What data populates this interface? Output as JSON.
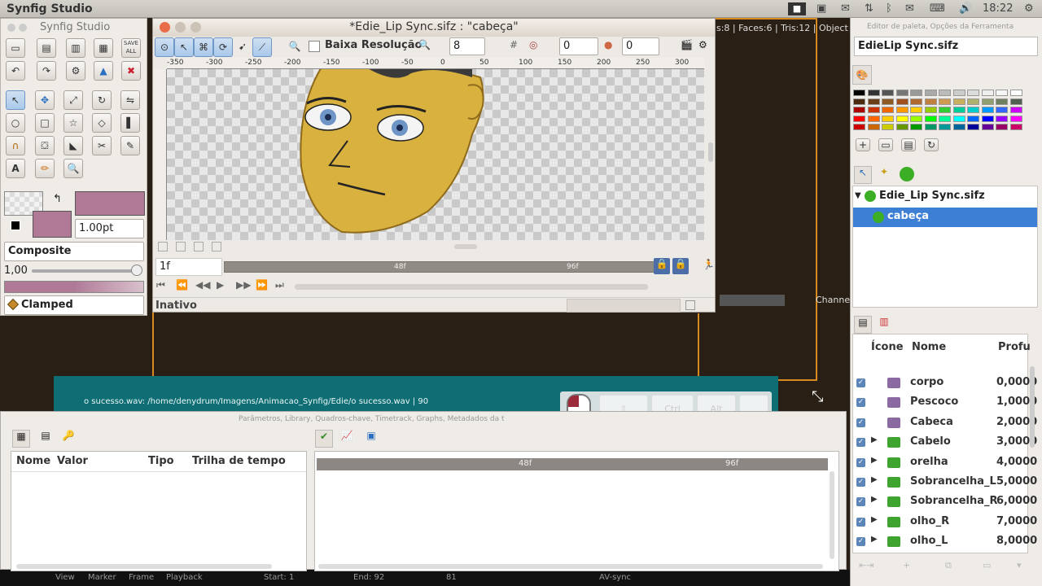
{
  "system": {
    "app_name": "Synfig Studio",
    "clock": "18:22"
  },
  "background": {
    "status_text": "s:8 | Faces:6 | Tris:12 | Object",
    "teal_text": "o sucesso.wav: /home/denydrum/Imagens/Animacao_Synfig/Edie/o sucesso.wav | 90",
    "channel_label": "Channe",
    "bottom_items": [
      "View",
      "Marker",
      "Frame",
      "Playback",
      "Start: 1",
      "End: 92",
      "81",
      "AV-sync"
    ],
    "keys": {
      "ctrl": "Ctrl",
      "alt": "Alt"
    }
  },
  "toolbox": {
    "title": "Synfig Studio",
    "save_all": "SAVE ALL",
    "width_value": "1.00pt",
    "blend_method": "Composite",
    "amount": "1,00",
    "interpolation": "Clamped"
  },
  "canvas": {
    "title": "*Edie_Lip Sync.sifz : \"cabeça\"",
    "low_res_label": "Baixa Resolução",
    "res_value": "8",
    "value_a": "0",
    "value_b": "0",
    "ruler_ticks": [
      "-350",
      "-300",
      "-250",
      "-200",
      "-150",
      "-100",
      "-50",
      "0",
      "50",
      "100",
      "150",
      "200",
      "250",
      "300"
    ],
    "current_frame": "1f",
    "timeline_marks": [
      "48f",
      "96f"
    ],
    "status": "Inativo"
  },
  "right_panel": {
    "header": "Editor de paleta, Opções da Ferramenta",
    "file_combo": "EdieLip Sync.sifz",
    "tree": {
      "root": "Edie_Lip Sync.sifz",
      "child": "cabeça"
    },
    "layers": {
      "columns": [
        "Ícone",
        "Nome",
        "Profu"
      ],
      "rows": [
        {
          "name": "corpo",
          "depth": "0,0000",
          "type": "region",
          "expandable": false
        },
        {
          "name": "Pescoco",
          "depth": "1,0000",
          "type": "region",
          "expandable": false
        },
        {
          "name": "Cabeca",
          "depth": "2,0000",
          "type": "region",
          "expandable": false
        },
        {
          "name": "Cabelo",
          "depth": "3,0000",
          "type": "group",
          "expandable": true
        },
        {
          "name": "orelha",
          "depth": "4,0000",
          "type": "group",
          "expandable": true
        },
        {
          "name": "Sobrancelha_L",
          "depth": "5,0000",
          "type": "group",
          "expandable": true
        },
        {
          "name": "Sobrancelha_R",
          "depth": "6,0000",
          "type": "group",
          "expandable": true
        },
        {
          "name": "olho_R",
          "depth": "7,0000",
          "type": "group",
          "expandable": true
        },
        {
          "name": "olho_L",
          "depth": "8,0000",
          "type": "group",
          "expandable": true
        }
      ]
    }
  },
  "bottom_panel": {
    "title": "Parâmetros, Library, Quadros-chave, Timetrack, Graphs, Metadados da t",
    "columns": [
      "Nome",
      "Valor",
      "Tipo",
      "Trilha de tempo"
    ],
    "timeline_marks": [
      "48f",
      "96f"
    ]
  },
  "colors": {
    "accent_frame": "#d88a20",
    "fill": "#b07a97",
    "selection": "#3e7fd6",
    "face": "#d9b13f"
  }
}
